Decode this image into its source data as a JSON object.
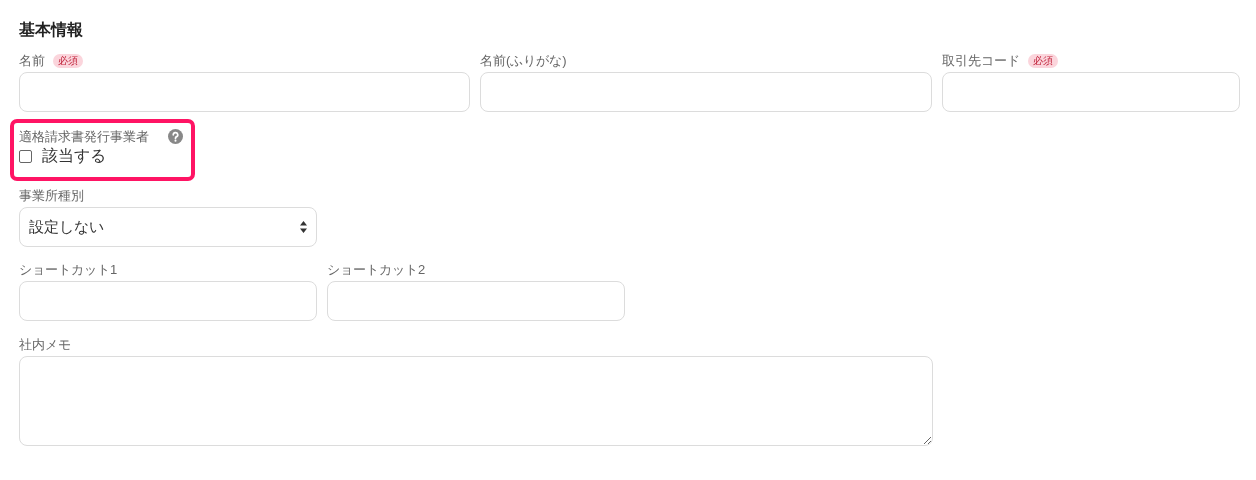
{
  "section_title": "基本情報",
  "name_row": [
    {
      "label": "名前",
      "badge": "必須"
    },
    {
      "label": "名前(ふりがな)"
    },
    {
      "label": "取引先コード",
      "badge": "必須"
    }
  ],
  "invoice_issuer": {
    "label": "適格請求書発行事業者",
    "highlighted": true,
    "checkbox": {
      "label": "該当する",
      "checked": false
    }
  },
  "office_type": {
    "label": "事業所種別",
    "value": "設定しない"
  },
  "shortcuts": [
    {
      "label": "ショートカット1"
    },
    {
      "label": "ショートカット2"
    }
  ],
  "memo": {
    "label": "社内メモ"
  }
}
